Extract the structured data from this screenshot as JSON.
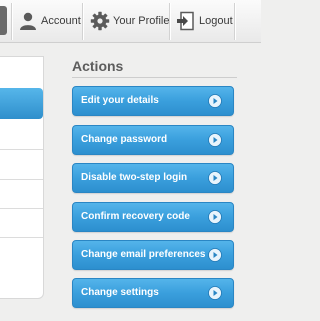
{
  "nav": {
    "items": [
      {
        "label": "Account",
        "icon": "user-icon"
      },
      {
        "label": "Your Profile",
        "icon": "gear-icon"
      },
      {
        "label": "Logout",
        "icon": "logout-icon"
      }
    ]
  },
  "actions": {
    "title": "Actions",
    "buttons": [
      {
        "label": "Edit your details"
      },
      {
        "label": "Change password"
      },
      {
        "label": "Disable two-step login"
      },
      {
        "label": "Confirm recovery code"
      },
      {
        "label": "Change email preferences"
      },
      {
        "label": "Change settings"
      }
    ]
  },
  "colors": {
    "button_blue": "#3a9fdd",
    "background": "#efefee",
    "title_gray": "#5d5d5d"
  }
}
